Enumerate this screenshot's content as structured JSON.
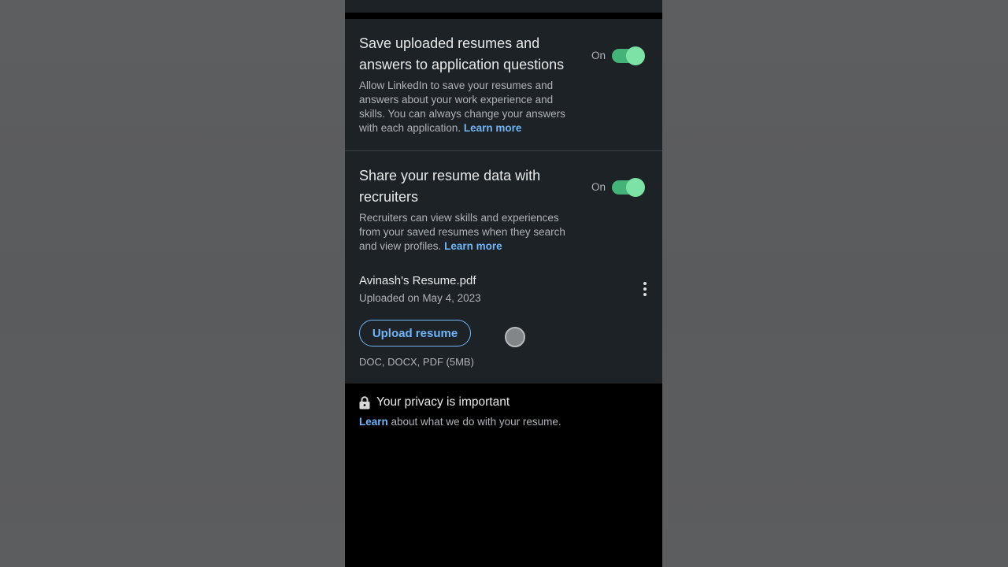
{
  "settings": [
    {
      "title": "Save uploaded resumes and answers to application questions",
      "description": "Allow LinkedIn to save your resumes and answers about your work experience and skills. You can always change your answers with each application.",
      "link": "Learn more",
      "toggle_label": "On"
    },
    {
      "title": "Share your resume data with recruiters",
      "description": "Recruiters can view skills and experiences from your saved resumes when they search and view profiles.",
      "link": "Learn more",
      "toggle_label": "On"
    }
  ],
  "resume": {
    "file_name": "Avinash's Resume.pdf",
    "uploaded": "Uploaded on May 4, 2023",
    "upload_button": "Upload resume",
    "file_types": "DOC, DOCX, PDF (5MB)"
  },
  "privacy": {
    "title": "Your privacy is important",
    "link": "Learn",
    "text": " about what we do with your resume."
  },
  "icons": {
    "lock": "lock-icon",
    "more": "more-vertical-icon"
  },
  "colors": {
    "accent_link": "#70b5f9",
    "toggle_on": "#44b37a",
    "card_bg": "#1d2226"
  }
}
